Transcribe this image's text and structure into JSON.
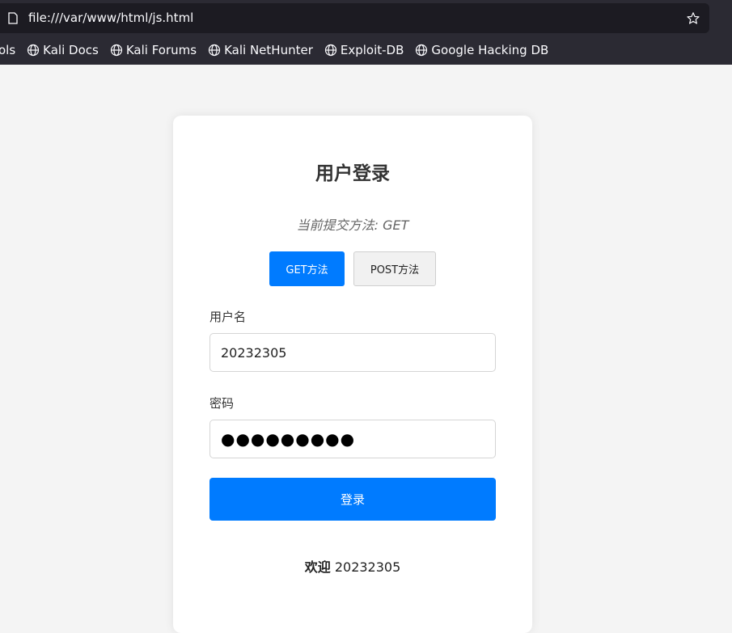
{
  "browser": {
    "url": "file:///var/www/html/js.html",
    "bookmarks": [
      "ols",
      "Kali Docs",
      "Kali Forums",
      "Kali NetHunter",
      "Exploit-DB",
      "Google Hacking DB"
    ]
  },
  "form": {
    "title": "用户登录",
    "method_note": "当前提交方法: GET",
    "get_button": "GET方法",
    "post_button": "POST方法",
    "username_label": "用户名",
    "username_value": "20232305",
    "password_label": "密码",
    "password_value": "●●●●●●●●●",
    "submit_label": "登录",
    "welcome_prefix": "欢迎",
    "welcome_name": "20232305"
  },
  "colors": {
    "accent": "#007bff",
    "chrome": "#2b2a33",
    "page_bg": "#f4f4f4"
  }
}
